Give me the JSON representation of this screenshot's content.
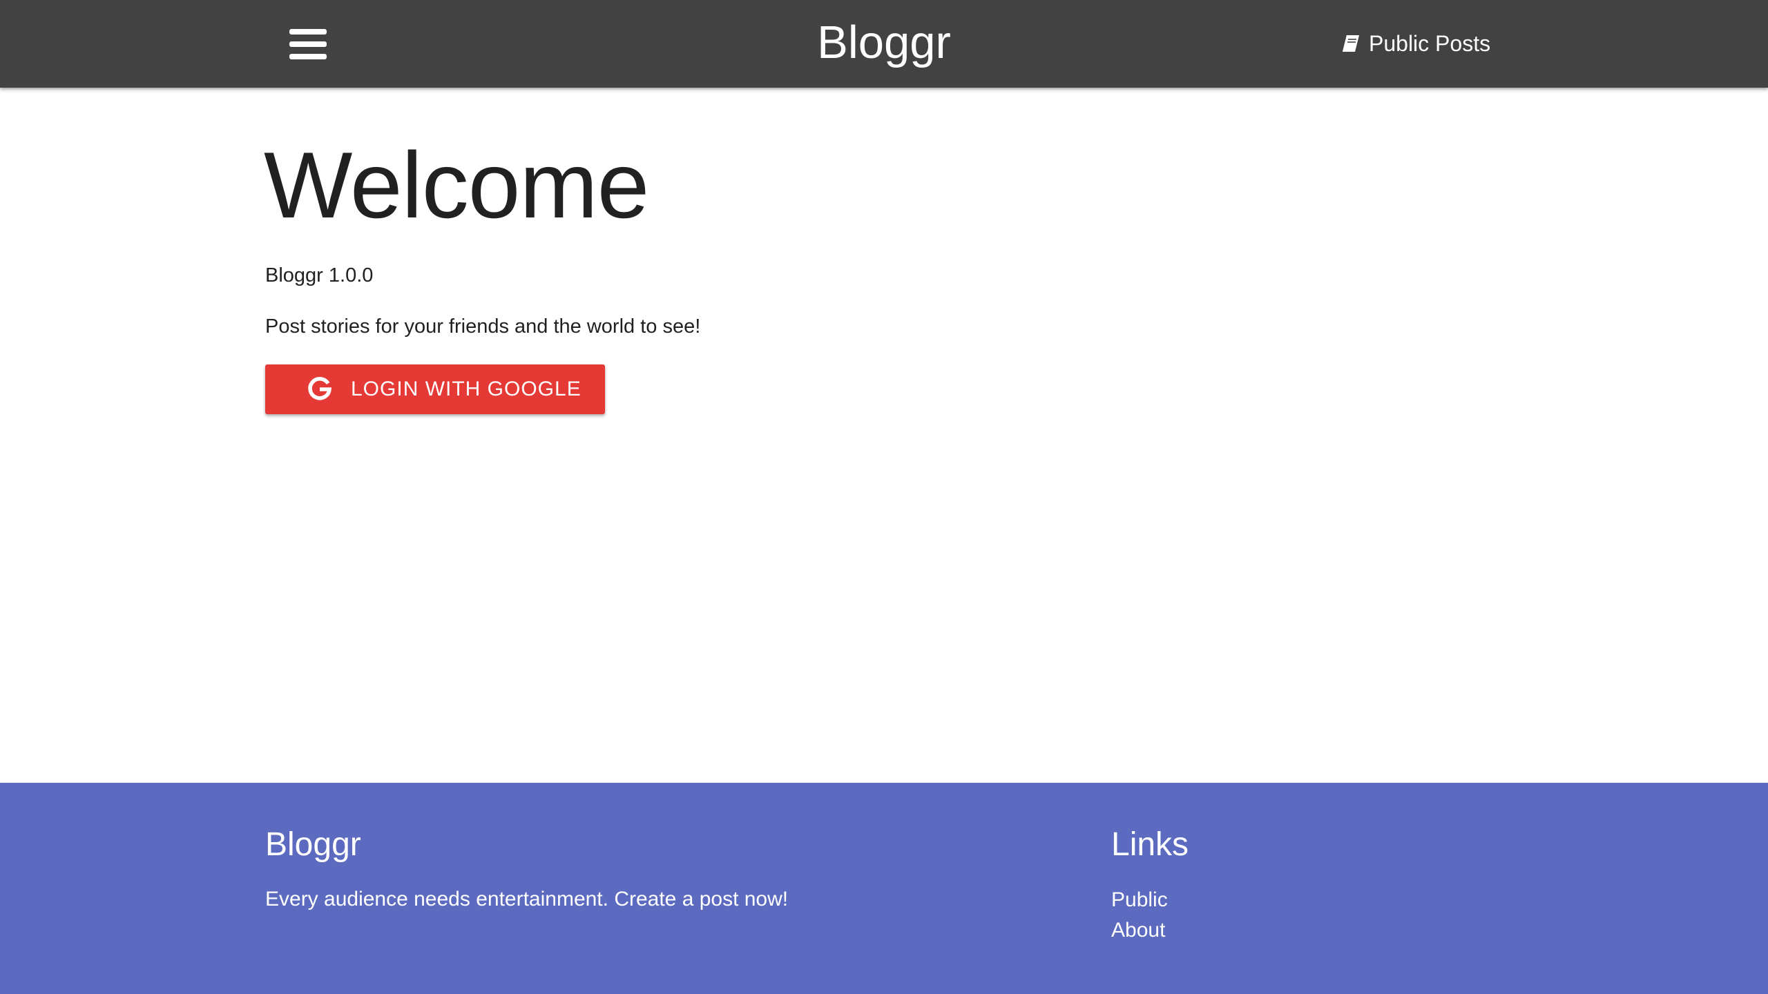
{
  "navbar": {
    "menu_icon": "hamburger-menu-icon",
    "brand": "Bloggr",
    "public_posts_icon": "book-icon",
    "public_posts_label": "Public Posts"
  },
  "main": {
    "heading": "Welcome",
    "version": "Bloggr 1.0.0",
    "tagline": "Post stories for your friends and the world to see!",
    "login_button": {
      "icon": "google-icon",
      "label": "LOGIN WITH GOOGLE"
    }
  },
  "footer": {
    "title": "Bloggr",
    "text": "Every audience needs entertainment. Create a post now!",
    "links_title": "Links",
    "links": [
      {
        "label": "Public"
      },
      {
        "label": "About"
      }
    ]
  },
  "colors": {
    "navbar_bg": "#424242",
    "login_button_bg": "#e53935",
    "footer_bg": "#5c6bc0",
    "text_dark": "#212121",
    "text_light": "#ffffff"
  }
}
